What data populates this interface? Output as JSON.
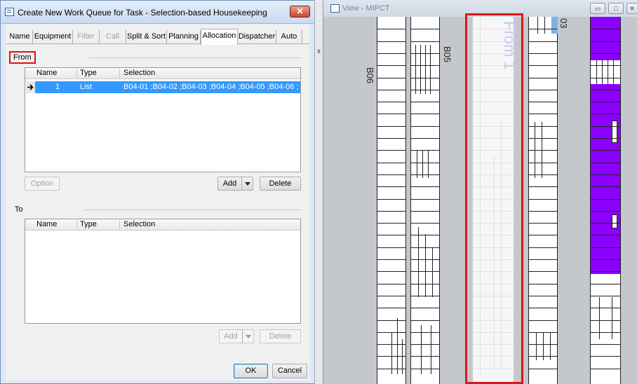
{
  "dialog": {
    "title": "Create New Work Queue for Task - Selection-based Housekeeping",
    "close_glyph": "✕",
    "tabs": [
      {
        "label": "Name",
        "state": "normal"
      },
      {
        "label": "Equipment",
        "state": "normal"
      },
      {
        "label": "Filter",
        "state": "disabled"
      },
      {
        "label": "Call",
        "state": "disabled"
      },
      {
        "label": "Split & Sort",
        "state": "normal"
      },
      {
        "label": "Planning",
        "state": "normal"
      },
      {
        "label": "Allocation",
        "state": "active"
      },
      {
        "label": "Dispatcher",
        "state": "normal"
      },
      {
        "label": "Auto",
        "state": "normal"
      }
    ],
    "from": {
      "label": "From",
      "columns": [
        "Name",
        "Type",
        "Selection"
      ],
      "rows": [
        {
          "name": "1",
          "type": "List",
          "selection": "B04-01 ;B04-02 ;B04-03 ;B04-04 ;B04-05 ;B04-06 ;B04..."
        }
      ],
      "option_label": "Option",
      "add_label": "Add",
      "delete_label": "Delete"
    },
    "to": {
      "label": "To",
      "columns": [
        "Name",
        "Type",
        "Selection"
      ],
      "add_label": "Add",
      "delete_label": "Delete"
    },
    "ok_label": "OK",
    "cancel_label": "Cancel"
  },
  "view": {
    "title": "View - MIPCT",
    "bay_labels": [
      "B06",
      "B05",
      "From 1",
      "03"
    ],
    "gutter_text": "x"
  },
  "colors": {
    "selection": "#3399ff",
    "highlight_frame": "#d71919",
    "occupied": "#8b00ff",
    "ghost_label": "#c7c8f5"
  }
}
